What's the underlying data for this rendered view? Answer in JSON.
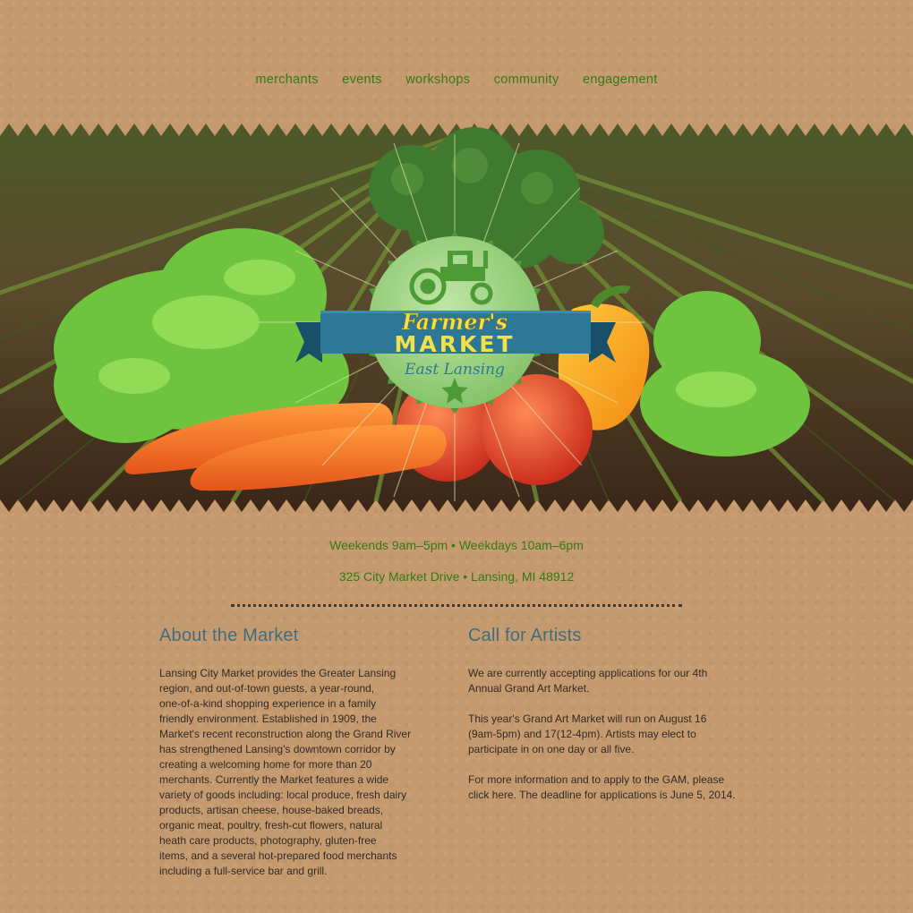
{
  "nav": {
    "items": [
      {
        "label": "merchants"
      },
      {
        "label": "events"
      },
      {
        "label": "workshops"
      },
      {
        "label": "community"
      },
      {
        "label": "engagement"
      }
    ]
  },
  "logo": {
    "title_line1": "Farmer's",
    "title_line2": "MARKET",
    "subtitle": "East Lansing"
  },
  "info": {
    "hours": "Weekends 9am–5pm  •  Weekdays 10am–6pm",
    "address": "325 City Market Drive • Lansing, MI 48912"
  },
  "about": {
    "heading": "About the Market",
    "body": "Lansing City Market provides the Greater Lansing\nregion, and out-of-town guests, a year-round,\none-of-a-kind shopping experience in a family\nfriendly environment. Established in 1909, the\nMarket's recent reconstruction along the Grand River\n has strengthened Lansing's downtown corridor by\ncreating a welcoming home for more than 20\nmerchants. Currently the Market features a wide\nvariety of goods including: local produce, fresh dairy\nproducts, artisan cheese, house-baked breads,\norganic meat, poultry, fresh-cut flowers, natural\nheath care products, photography, gluten-free\nitems,  and a several hot-prepared food merchants\nincluding a full-service bar and grill."
  },
  "artists": {
    "heading": "Call for Artists",
    "p1": "We are currently accepting applications for our 4th\nAnnual Grand Art Market.",
    "p2": "This year's Grand Art Market will run on August 16\n(9am-5pm) and 17(12-4pm). Artists may elect to\nparticipate in on one day or all five.",
    "p3": "For more information and to apply to the GAM, please\nclick here. The deadline for applications is June 5, 2014."
  }
}
